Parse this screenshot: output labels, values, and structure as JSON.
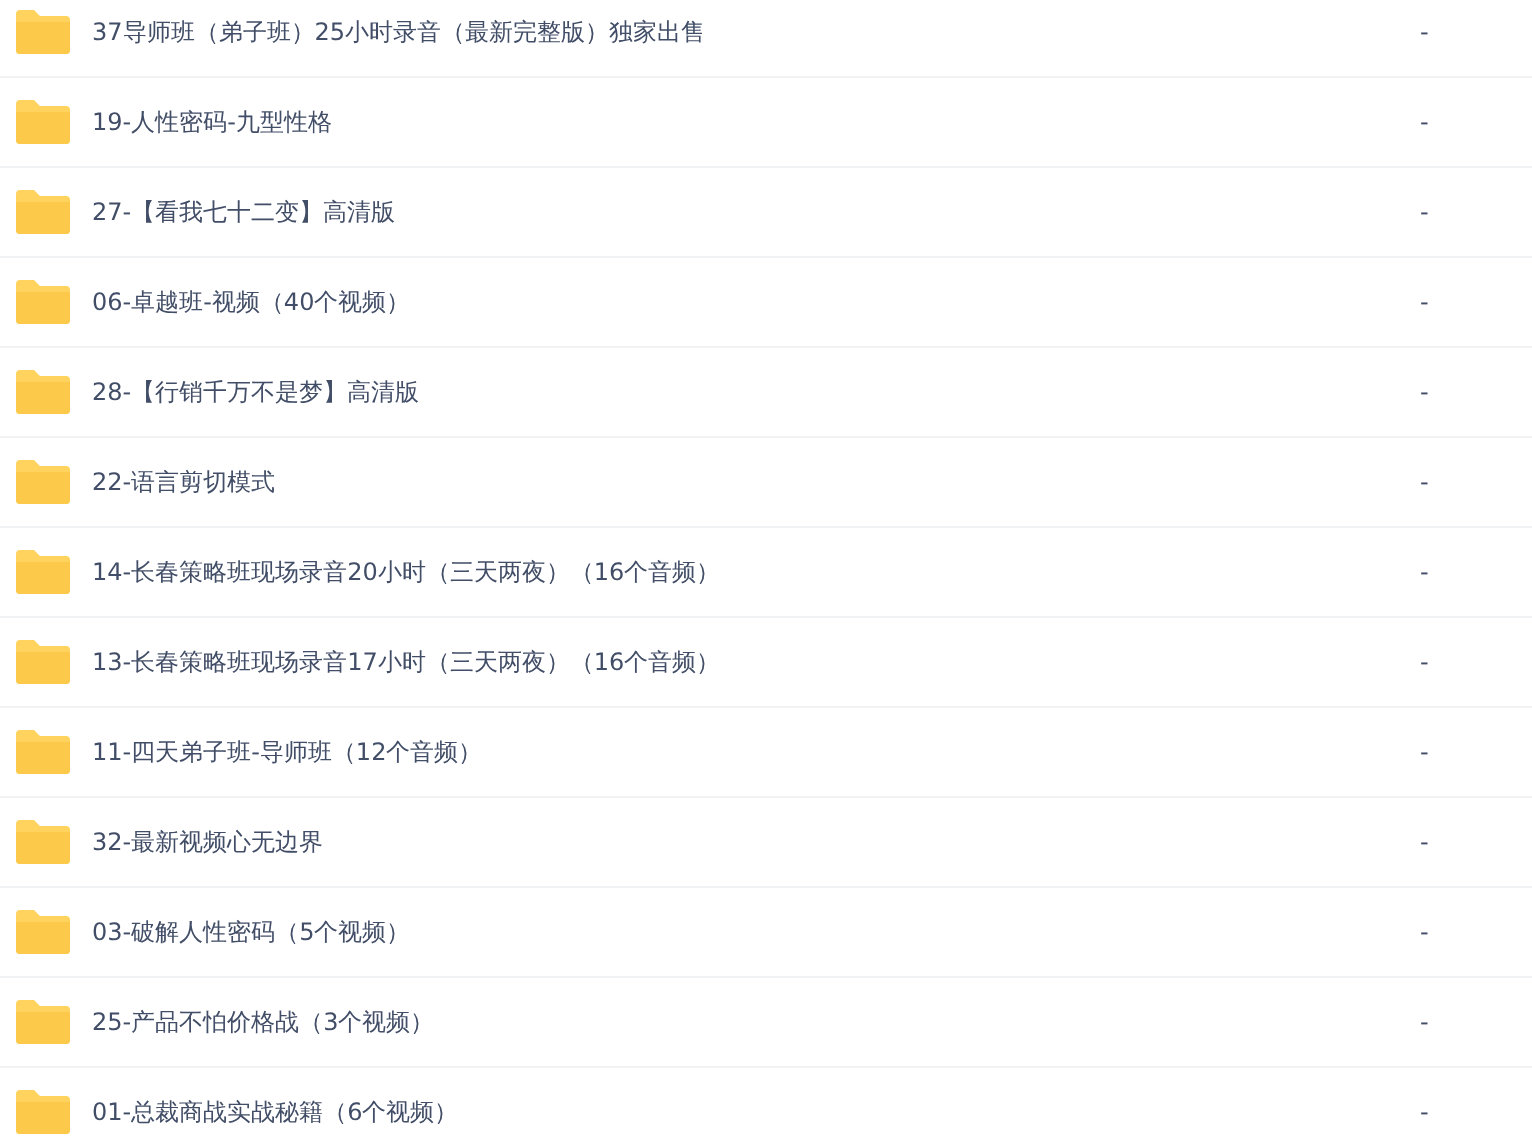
{
  "files": [
    {
      "name": "37导师班（弟子班）25小时录音（最新完整版）独家出售",
      "size": "-"
    },
    {
      "name": "19-人性密码-九型性格",
      "size": "-"
    },
    {
      "name": "27-【看我七十二变】高清版",
      "size": "-"
    },
    {
      "name": "06-卓越班-视频（40个视频）",
      "size": "-"
    },
    {
      "name": "28-【行销千万不是梦】高清版",
      "size": "-"
    },
    {
      "name": "22-语言剪切模式",
      "size": "-"
    },
    {
      "name": "14-长春策略班现场录音20小时（三天两夜）（16个音频）",
      "size": "-"
    },
    {
      "name": "13-长春策略班现场录音17小时（三天两夜）（16个音频）",
      "size": "-"
    },
    {
      "name": "11-四天弟子班-导师班（12个音频）",
      "size": "-"
    },
    {
      "name": "32-最新视频心无边界",
      "size": "-"
    },
    {
      "name": "03-破解人性密码（5个视频）",
      "size": "-"
    },
    {
      "name": "25-产品不怕价格战（3个视频）",
      "size": "-"
    },
    {
      "name": "01-总裁商战实战秘籍（6个视频）",
      "size": "-"
    }
  ]
}
